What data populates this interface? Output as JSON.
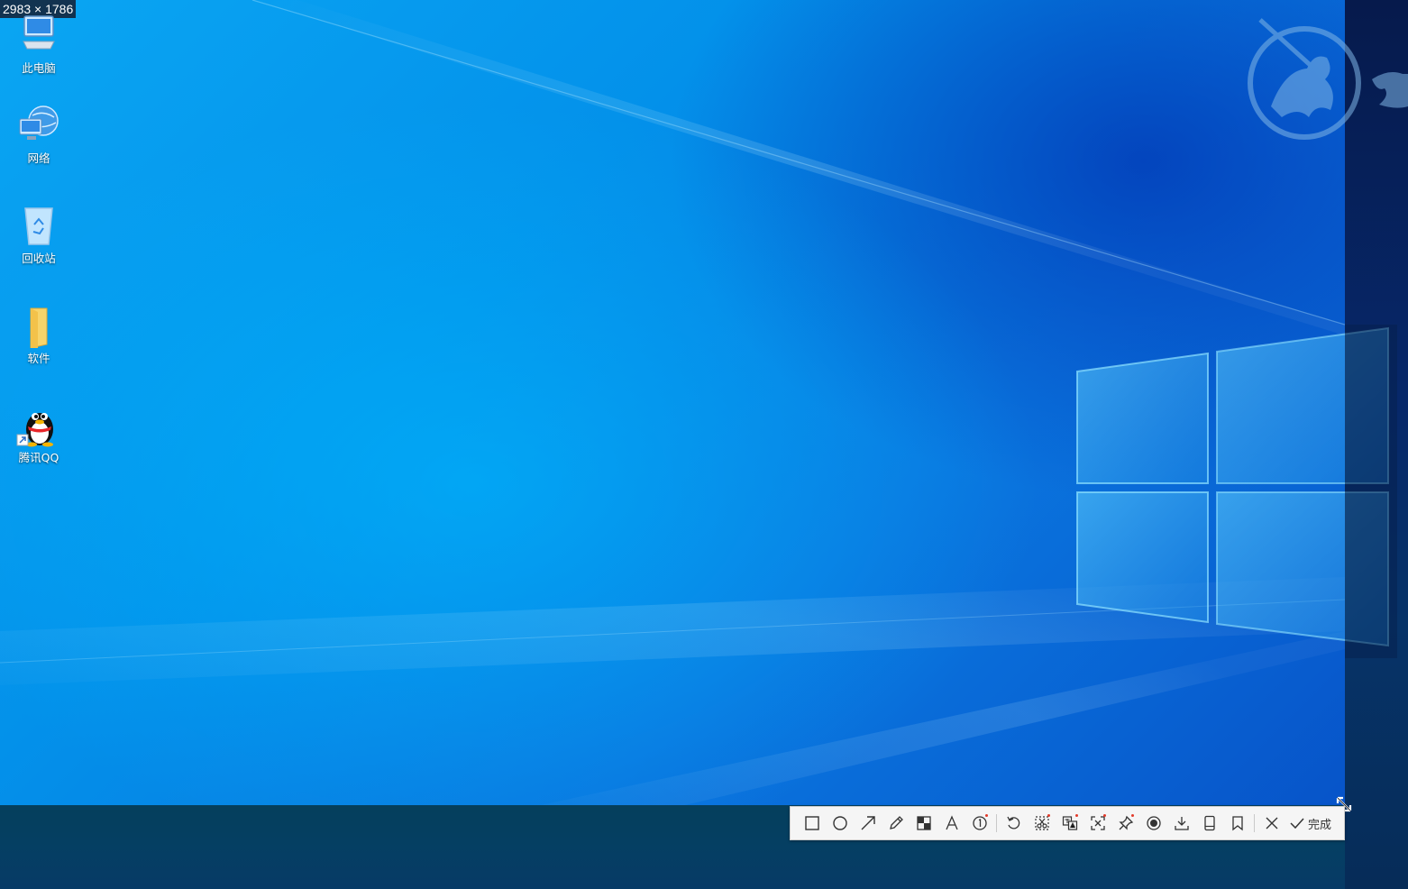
{
  "capture": {
    "size_text": "2983 × 1786"
  },
  "desktop": {
    "icons": [
      {
        "label": "此电脑",
        "icon": "computer-icon"
      },
      {
        "label": "网络",
        "icon": "network-icon"
      },
      {
        "label": "回收站",
        "icon": "recycle-bin-icon"
      },
      {
        "label": "软件",
        "icon": "folder-icon"
      },
      {
        "label": "腾讯QQ",
        "icon": "qq-penguin-icon"
      }
    ]
  },
  "toolbar": {
    "tools": [
      {
        "name": "rectangle-tool",
        "icon": "rectangle-icon"
      },
      {
        "name": "ellipse-tool",
        "icon": "circle-icon"
      },
      {
        "name": "arrow-tool",
        "icon": "arrow-icon"
      },
      {
        "name": "pen-tool",
        "icon": "pencil-icon"
      },
      {
        "name": "mosaic-tool",
        "icon": "mosaic-icon"
      },
      {
        "name": "text-tool",
        "icon": "text-icon"
      },
      {
        "name": "number-tool",
        "icon": "numbered-marker-icon"
      },
      {
        "name": "undo-tool",
        "icon": "undo-icon"
      },
      {
        "name": "ocr-tool",
        "icon": "scissors-icon"
      },
      {
        "name": "translate-tool",
        "icon": "translate-icon"
      },
      {
        "name": "screen-recognize-tool",
        "icon": "scan-icon"
      },
      {
        "name": "pin-tool",
        "icon": "pin-icon"
      },
      {
        "name": "record-tool",
        "icon": "record-icon"
      },
      {
        "name": "save-tool",
        "icon": "download-icon"
      },
      {
        "name": "phone-tool",
        "icon": "phone-icon"
      },
      {
        "name": "favorite-tool",
        "icon": "bookmark-icon"
      }
    ],
    "close_icon": "close-icon",
    "done_label": "完成"
  },
  "colors": {
    "toolbar_bg": "#f5f5f5",
    "icon_stroke": "#333333",
    "badge_dot": "#e23a2a"
  }
}
